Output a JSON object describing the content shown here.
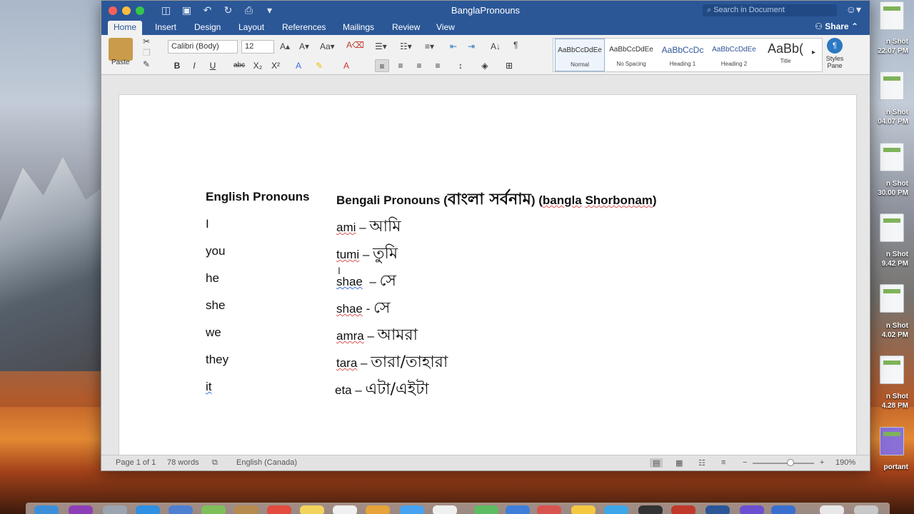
{
  "window": {
    "title": "BanglaPronouns",
    "search_placeholder": "Search in Document"
  },
  "tabs": [
    "Home",
    "Insert",
    "Design",
    "Layout",
    "References",
    "Mailings",
    "Review",
    "View"
  ],
  "share_label": "Share",
  "ribbon": {
    "paste_label": "Paste",
    "font_name": "Calibri (Body)",
    "font_size": "12",
    "styles": [
      {
        "preview": "AaBbCcDdEe",
        "name": "Normal"
      },
      {
        "preview": "AaBbCcDdEe",
        "name": "No Spacing"
      },
      {
        "preview": "AaBbCcDc",
        "name": "Heading 1"
      },
      {
        "preview": "AaBbCcDdEe",
        "name": "Heading 2"
      },
      {
        "preview": "AaBb(",
        "name": "Title"
      }
    ],
    "styles_pane_label": "Styles Pane"
  },
  "document": {
    "header_left": "English Pronouns",
    "header_right_a": "Bengali Pronouns (",
    "header_right_bn": "বাংলা সর্বনাম",
    "header_right_b": ") (",
    "header_right_c1": "bangla",
    "header_right_c2": "Shorbonam",
    "header_right_d": ")",
    "rows": [
      {
        "en": "I",
        "translit": "ami",
        "sep": " – ",
        "bn": "আমি"
      },
      {
        "en": "you",
        "translit": "tumi",
        "sep": " – ",
        "bn": "তুমি"
      },
      {
        "en": "he",
        "translit": "shae",
        "sep": "  – ",
        "bn": "সে"
      },
      {
        "en": "she",
        "translit": "shae",
        "sep": " - ",
        "bn": "সে"
      },
      {
        "en": "we",
        "translit": "amra",
        "sep": " – ",
        "bn": "আমরা"
      },
      {
        "en": "they",
        "translit": "tara",
        "sep": " – ",
        "bn": "তারা/তাহারা"
      },
      {
        "en": "it",
        "translit": "eta",
        "sep": " – ",
        "bn": "এটা/এইটা"
      }
    ]
  },
  "status": {
    "page": "Page 1 of 1",
    "words": "78 words",
    "language": "English (Canada)",
    "zoom": "190%"
  },
  "desktop_labels": [
    "n Shot",
    "22.07 PM",
    "n Shot",
    "04.07 PM",
    "n Shot",
    "30.00 PM",
    "n Shot",
    "9.42 PM",
    "n Shot",
    "4.02 PM",
    "n Shot",
    "4.28 PM",
    "portant"
  ],
  "colors": {
    "accent": "#2b5797"
  }
}
